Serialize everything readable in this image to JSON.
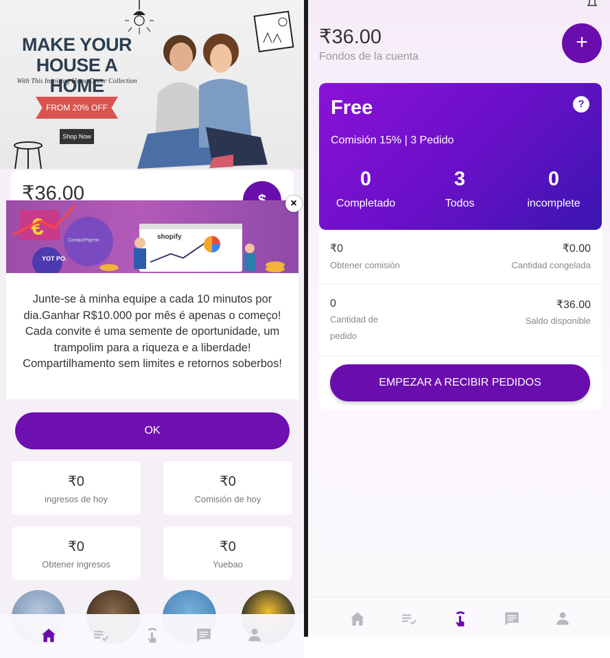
{
  "left": {
    "banner": {
      "title_line1": "MAKE YOUR",
      "title_line2": "HOUSE A HOME",
      "subtitle": "With This Inspiring Home Decor Collection",
      "ribbon": "FROM 20% OFF",
      "button": "Shop Now"
    },
    "balance": "₹36.00",
    "dollar_icon": "$",
    "modal": {
      "text": "Junte-se à minha equipe a cada 10 minutos por dia.Ganhar R$10.000 por mês é apenas o começo! Cada convite é uma semente de oportunidade, um trampolim para a riqueza e a liberdade! Compartilhamento sem limites e retornos soberbos!",
      "ok": "OK",
      "close": "×",
      "image_labels": {
        "shopify": "shopify",
        "yotpo": "YOT PO.",
        "euro": "€",
        "contact": "ContactPigeon"
      }
    },
    "stats": [
      {
        "value": "₹0",
        "label": "ingresos de hoy"
      },
      {
        "value": "₹0",
        "label": "Comisión de hoy"
      },
      {
        "value": "₹0",
        "label": "Obtener ingresos"
      },
      {
        "value": "₹0",
        "label": "Yuebao"
      }
    ],
    "nav": [
      "home-icon",
      "list-check-icon",
      "tap-icon",
      "chat-icon",
      "person-icon"
    ],
    "accent": "#6a0dad"
  },
  "right": {
    "balance": "₹36.00",
    "balance_label": "Fondos de la cuenta",
    "plus": "+",
    "plan": {
      "name": "Free",
      "help": "?",
      "commission": "Comisión 15% | 3 Pedido",
      "cols": [
        {
          "n": "0",
          "t": "Completado"
        },
        {
          "n": "3",
          "t": "Todos"
        },
        {
          "n": "0",
          "t": "incomplete"
        }
      ]
    },
    "rows": [
      {
        "lv": "₹0",
        "ll": "Obtener comisión",
        "rv": "₹0.00",
        "rl": "Cantidad congelada"
      },
      {
        "lv": "0",
        "ll": "Cantidad de pedido",
        "rv": "₹36.00",
        "rl": "Saldo disponible"
      }
    ],
    "start": "EMPEZAR A RECIBIR PEDIDOS",
    "nav": [
      "home-icon",
      "list-check-icon",
      "tap-icon",
      "chat-icon",
      "person-icon"
    ]
  }
}
